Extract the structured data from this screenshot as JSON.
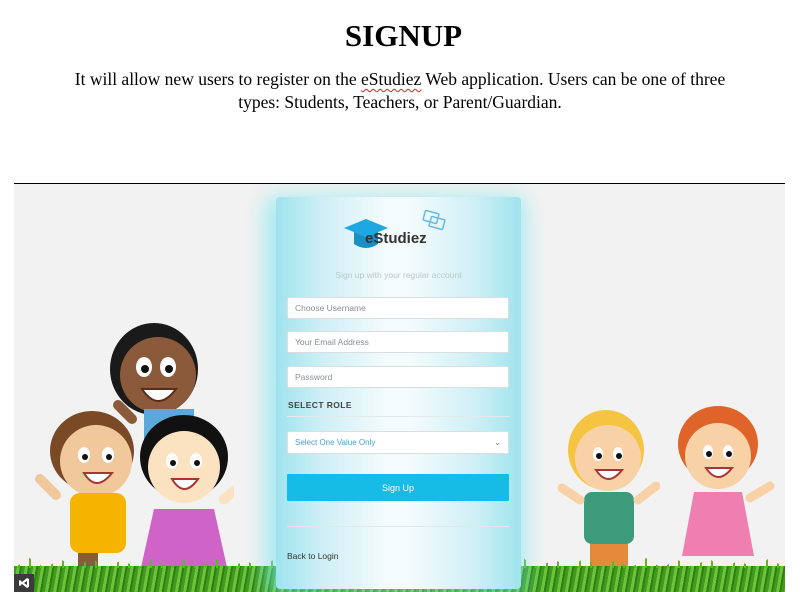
{
  "document": {
    "title": "SIGNUP",
    "description_before": "It will allow new users to register on the ",
    "description_link": "eStudiez",
    "description_after": " Web application. Users can be one of three types: Students, Teachers, or Parent/Guardian."
  },
  "signup_card": {
    "logo_text": "eStudiez",
    "subtitle": "Sign up with your regular account",
    "username_placeholder": "Choose Username",
    "email_placeholder": "Your Email Address",
    "password_placeholder": "Password",
    "role_label": "SELECT ROLE",
    "role_select_value": "Select One Value Only",
    "signup_button": "Sign Up",
    "back_link": "Back to Login"
  },
  "icons": [
    "graduation-cap-logo-icon",
    "books-icon",
    "chevron-down-icon",
    "visual-studio-icon"
  ],
  "colors": {
    "accent": "#17bce6",
    "card_glow": "#6ee6f0",
    "select_text": "#4aa0d6",
    "grass": "#4fa82a"
  }
}
